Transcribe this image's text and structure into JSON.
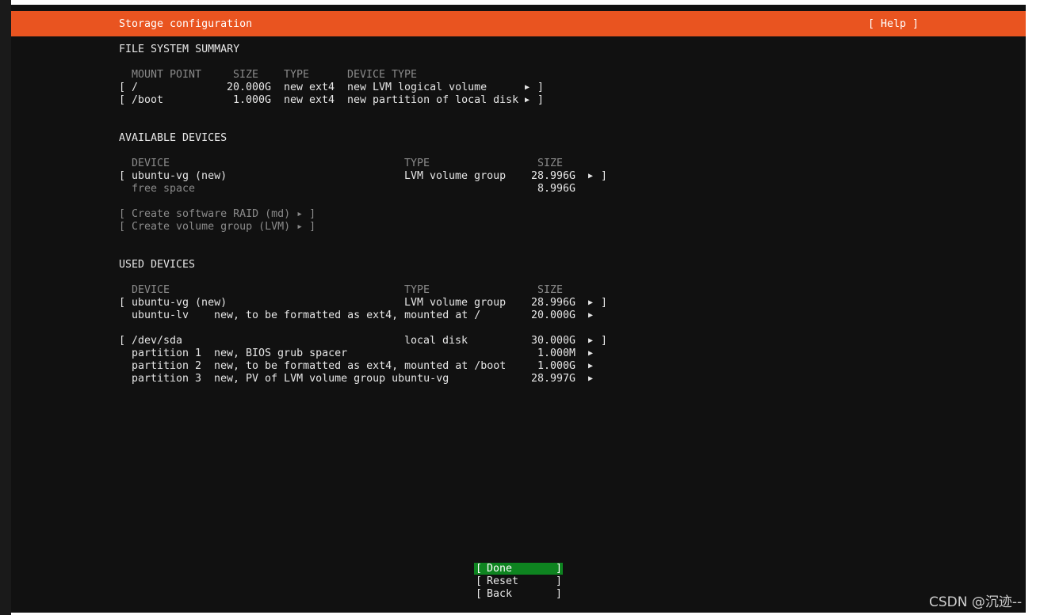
{
  "header": {
    "title": "Storage configuration",
    "help_label": "[ Help ]"
  },
  "fs_summary": {
    "title": "FILE SYSTEM SUMMARY",
    "columns": {
      "mount": "MOUNT POINT",
      "size": "SIZE",
      "type": "TYPE",
      "device_type": "DEVICE TYPE"
    },
    "rows": [
      {
        "mount": "/",
        "size": "20.000G",
        "type": "new ext4",
        "device_type": "new LVM logical volume"
      },
      {
        "mount": "/boot",
        "size": "1.000G",
        "type": "new ext4",
        "device_type": "new partition of local disk"
      }
    ]
  },
  "available": {
    "title": "AVAILABLE DEVICES",
    "columns": {
      "device": "DEVICE",
      "type": "TYPE",
      "size": "SIZE"
    },
    "vg": {
      "device": "ubuntu-vg (new)",
      "type": "LVM volume group",
      "size": "28.996G"
    },
    "free": {
      "label": "free space",
      "size": "8.996G"
    },
    "actions": [
      "[ Create software RAID (md) ▸ ]",
      "[ Create volume group (LVM) ▸ ]"
    ]
  },
  "used": {
    "title": "USED DEVICES",
    "columns": {
      "device": "DEVICE",
      "type": "TYPE",
      "size": "SIZE"
    },
    "vg": {
      "device": "ubuntu-vg (new)",
      "type": "LVM volume group",
      "size": "28.996G"
    },
    "lv": {
      "name": "ubuntu-lv",
      "desc": "new, to be formatted as ext4, mounted at /",
      "size": "20.000G"
    },
    "disk": {
      "device": "/dev/sda",
      "type": "local disk",
      "size": "30.000G"
    },
    "partitions": [
      {
        "name": "partition 1",
        "desc": "new, BIOS grub spacer",
        "size": "1.000M"
      },
      {
        "name": "partition 2",
        "desc": "new, to be formatted as ext4, mounted at /boot",
        "size": "1.000G"
      },
      {
        "name": "partition 3",
        "desc": "new, PV of LVM volume group ubuntu-vg",
        "size": "28.997G"
      }
    ]
  },
  "buttons": {
    "done": "Done",
    "reset": "Reset",
    "back": "Back"
  },
  "glyphs": {
    "open": "[",
    "close": "]",
    "arrow": "▶"
  },
  "watermark": "CSDN @沉迹--",
  "colors": {
    "header": "#e95420",
    "done_bg": "#0e8420",
    "background": "#111111"
  }
}
